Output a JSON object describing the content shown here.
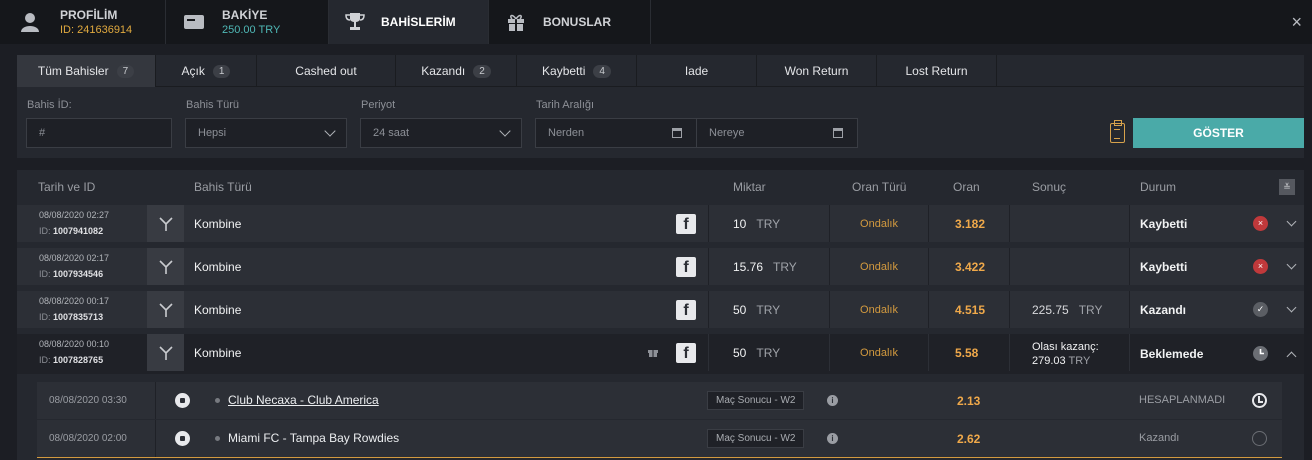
{
  "top_tabs": [
    {
      "label": "PROFİLİM",
      "sub": "ID: 241636914",
      "sub_color": "#e0a93f"
    },
    {
      "label": "BAKİYE",
      "sub": "250.00 TRY",
      "sub_color": "#4fb8b6"
    },
    {
      "label": "BAHİSLERİM"
    },
    {
      "label": "BONUSLAR"
    }
  ],
  "filter_tabs": [
    {
      "label": "Tüm Bahisler",
      "count": "7"
    },
    {
      "label": "Açık",
      "count": "1"
    },
    {
      "label": "Cashed out"
    },
    {
      "label": "Kazandı",
      "count": "2"
    },
    {
      "label": "Kaybetti",
      "count": "4"
    },
    {
      "label": "Iade"
    },
    {
      "label": "Won Return"
    },
    {
      "label": "Lost Return"
    }
  ],
  "filters": {
    "bet_id_label": "Bahis İD:",
    "bet_id_placeholder": "#",
    "bet_type_label": "Bahis Türü",
    "bet_type_value": "Hepsi",
    "period_label": "Periyot",
    "period_value": "24 saat",
    "date_range_label": "Tarih Aralığı",
    "from_placeholder": "Nerden",
    "to_placeholder": "Nereye",
    "show_button": "GÖSTER"
  },
  "columns": {
    "date_id": "Tarih ve ID",
    "bet_type": "Bahis Türü",
    "amount": "Miktar",
    "odds_type": "Oran Türü",
    "odds": "Oran",
    "result": "Sonuç",
    "status": "Durum"
  },
  "bets": [
    {
      "date": "08/08/2020 02:27",
      "id_prefix": "ID: ",
      "id": "1007941082",
      "type": "Kombine",
      "amount": "10",
      "currency": "TRY",
      "odds_type": "Ondalık",
      "odds": "3.182",
      "result": "",
      "result_currency": "",
      "status": "Kaybetti"
    },
    {
      "date": "08/08/2020 02:17",
      "id_prefix": "ID: ",
      "id": "1007934546",
      "type": "Kombine",
      "amount": "15.76",
      "currency": "TRY",
      "odds_type": "Ondalık",
      "odds": "3.422",
      "result": "",
      "result_currency": "",
      "status": "Kaybetti"
    },
    {
      "date": "08/08/2020 00:17",
      "id_prefix": "ID: ",
      "id": "1007835713",
      "type": "Kombine",
      "amount": "50",
      "currency": "TRY",
      "odds_type": "Ondalık",
      "odds": "4.515",
      "result": "225.75",
      "result_currency": "TRY",
      "status": "Kazandı"
    },
    {
      "date": "08/08/2020 00:10",
      "id_prefix": "ID: ",
      "id": "1007828765",
      "type": "Kombine",
      "amount": "50",
      "currency": "TRY",
      "odds_type": "Ondalık",
      "odds": "5.58",
      "result_label": "Olası kazanç:",
      "result": "279.03",
      "result_currency": "TRY",
      "status": "Beklemede"
    }
  ],
  "selections": [
    {
      "date": "08/08/2020 03:30",
      "match": "Club Necaxa - Club America",
      "market": "Maç Sonucu - W2",
      "odds": "2.13",
      "status": "HESAPLANMADI"
    },
    {
      "date": "08/08/2020 02:00",
      "match": "Miami FC - Tampa Bay Rowdies",
      "market": "Maç Sonucu - W2",
      "odds": "2.62",
      "status": "Kazandı"
    }
  ],
  "icons": {
    "close": "×",
    "facebook": "f",
    "lost": "×",
    "won": "✓",
    "info": "i",
    "sort": "≚"
  }
}
